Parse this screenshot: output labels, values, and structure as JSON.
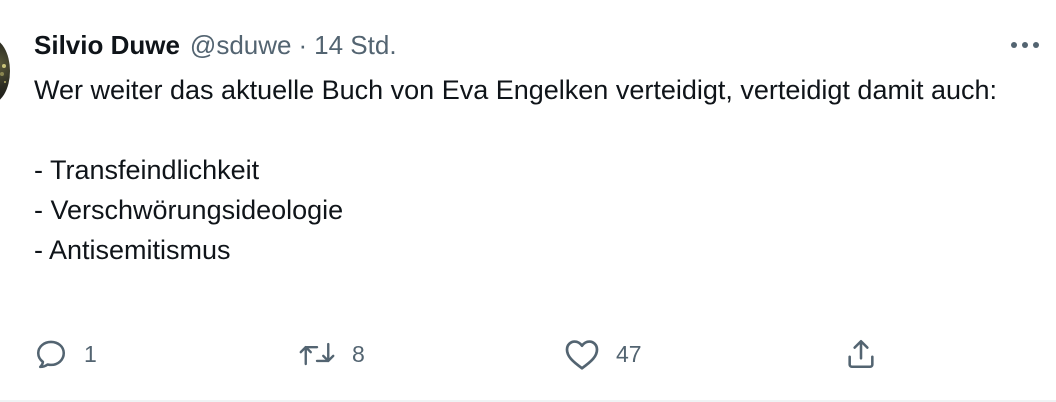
{
  "tweet": {
    "display_name": "Silvio Duwe",
    "handle": "@sduwe",
    "separator": "·",
    "time": "14 Std.",
    "text": "Wer weiter das aktuelle Buch von Eva Engelken verteidigt, verteidigt damit auch:\n\n- Transfeindlichkeit\n- Verschwörungsideologie\n- Antisemitismus",
    "reply_count": "1",
    "retweet_count": "8",
    "like_count": "47"
  },
  "icons": {
    "more": "more-horizontal-icon",
    "reply": "reply-bubble-icon",
    "retweet": "retweet-arrows-icon",
    "like": "heart-icon",
    "share": "share-upload-icon"
  },
  "colors": {
    "text_primary": "#0f1419",
    "text_secondary": "#536471",
    "divider": "#eff3f4"
  }
}
